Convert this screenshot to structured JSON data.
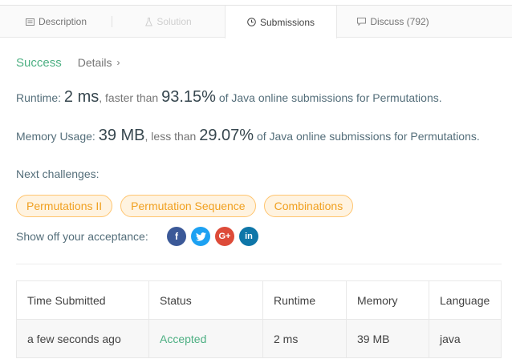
{
  "tabs": [
    {
      "label": "Description",
      "icon": "description-icon",
      "state": "normal"
    },
    {
      "label": "Solution",
      "icon": "flask-icon",
      "state": "disabled"
    },
    {
      "label": "Submissions",
      "icon": "clock-icon",
      "state": "active"
    },
    {
      "label": "Discuss (792)",
      "icon": "comment-icon",
      "state": "normal"
    }
  ],
  "result": {
    "status": "Success",
    "details": "Details",
    "details_chevron": "›"
  },
  "runtime": {
    "prefix": "Runtime: ",
    "value": "2 ms",
    "faster_than": ", faster than ",
    "percent": "93.15%",
    "suffix": " of Java online submissions for Permutations."
  },
  "memory": {
    "prefix": "Memory Usage: ",
    "value": "39 MB",
    "less_than": ", less than ",
    "percent": "29.07%",
    "suffix": " of Java online submissions for Permutations."
  },
  "next_challenges": {
    "label": "Next challenges:",
    "items": [
      "Permutations II",
      "Permutation Sequence",
      "Combinations"
    ]
  },
  "share": {
    "label": "Show off your acceptance:",
    "buttons": [
      "facebook-icon",
      "twitter-icon",
      "google-plus-icon",
      "linkedin-icon"
    ]
  },
  "table": {
    "headers": [
      "Time Submitted",
      "Status",
      "Runtime",
      "Memory",
      "Language"
    ],
    "rows": [
      [
        "a few seconds ago",
        "Accepted",
        "2 ms",
        "39 MB",
        "java"
      ]
    ]
  },
  "colors": {
    "success": "#4caf82",
    "chip_text": "#f0a020",
    "chip_bg": "#fff3e0"
  }
}
